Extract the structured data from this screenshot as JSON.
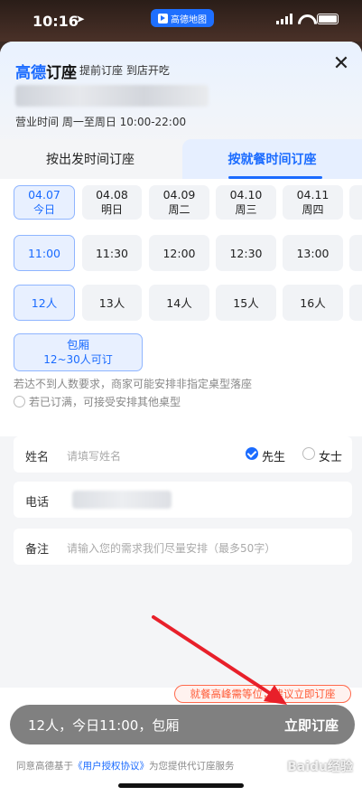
{
  "status": {
    "time": "10:16",
    "app_pill": "高德地图"
  },
  "header": {
    "brand_main": "高德",
    "brand_bold": "订座",
    "subtitle": "提前订座 到店开吃",
    "hours": "营业时间 周一至周日 10:00-22:00",
    "close_label": "✕"
  },
  "tabs": [
    {
      "label": "按出发时间订座",
      "active": false
    },
    {
      "label": "按就餐时间订座",
      "active": true
    }
  ],
  "dates": [
    {
      "date": "04.07",
      "day": "今日",
      "selected": true
    },
    {
      "date": "04.08",
      "day": "明日",
      "selected": false
    },
    {
      "date": "04.09",
      "day": "周二",
      "selected": false
    },
    {
      "date": "04.10",
      "day": "周三",
      "selected": false
    },
    {
      "date": "04.11",
      "day": "周四",
      "selected": false
    }
  ],
  "times": [
    {
      "label": "11:00",
      "selected": true
    },
    {
      "label": "11:30",
      "selected": false
    },
    {
      "label": "12:00",
      "selected": false
    },
    {
      "label": "12:30",
      "selected": false
    },
    {
      "label": "13:00",
      "selected": false
    }
  ],
  "party": [
    {
      "label": "12人",
      "selected": true
    },
    {
      "label": "13人",
      "selected": false
    },
    {
      "label": "14人",
      "selected": false
    },
    {
      "label": "15人",
      "selected": false
    },
    {
      "label": "16人",
      "selected": false
    }
  ],
  "room": {
    "title": "包厢",
    "range": "12~30人可订"
  },
  "hint_min": "若达不到人数要求，商家可能安排非指定桌型落座",
  "hint_full": "若已订满，可接受安排其他桌型",
  "form": {
    "name_label": "姓名",
    "name_placeholder": "请填写姓名",
    "gender_male": "先生",
    "gender_female": "女士",
    "phone_label": "电话",
    "note_label": "备注",
    "note_placeholder": "请输入您的需求我们尽量安排（最多50字）"
  },
  "warning": "就餐高峰需等位，建议立即订座",
  "cta": {
    "summary": "12人，今日11:00，包厢",
    "button": "立即订座"
  },
  "terms": {
    "prefix": "同意高德基于",
    "link": "《用户授权协议》",
    "suffix": "为您提供代订座服务"
  },
  "watermark": "Baidu经验",
  "colors": {
    "accent": "#1a6bff",
    "warning": "#ff5a36",
    "annotation": "#e8202a"
  }
}
